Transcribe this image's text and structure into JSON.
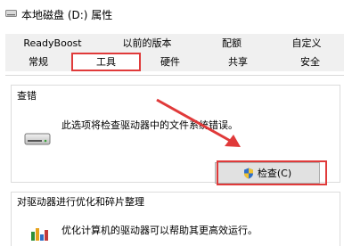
{
  "window": {
    "title": "本地磁盘 (D:) 属性"
  },
  "tabs_row1": [
    "ReadyBoost",
    "以前的版本",
    "配额",
    "自定义"
  ],
  "tabs_row2": [
    "常规",
    "工具",
    "硬件",
    "共享",
    "安全"
  ],
  "active_tab": "工具",
  "check_section": {
    "title": "查错",
    "description": "此选项将检查驱动器中的文件系统错误。",
    "button_label": "检查(C)"
  },
  "optimize_section": {
    "title": "对驱动器进行优化和碎片整理",
    "description": "优化计算机的驱动器可以帮助其更高效运行。"
  },
  "colors": {
    "highlight": "#e03a3a",
    "accent": "#1a7fd0"
  },
  "icons": [
    "drive-icon",
    "hard-drive-icon",
    "shield-icon",
    "defrag-icon",
    "arrow-annotation"
  ]
}
